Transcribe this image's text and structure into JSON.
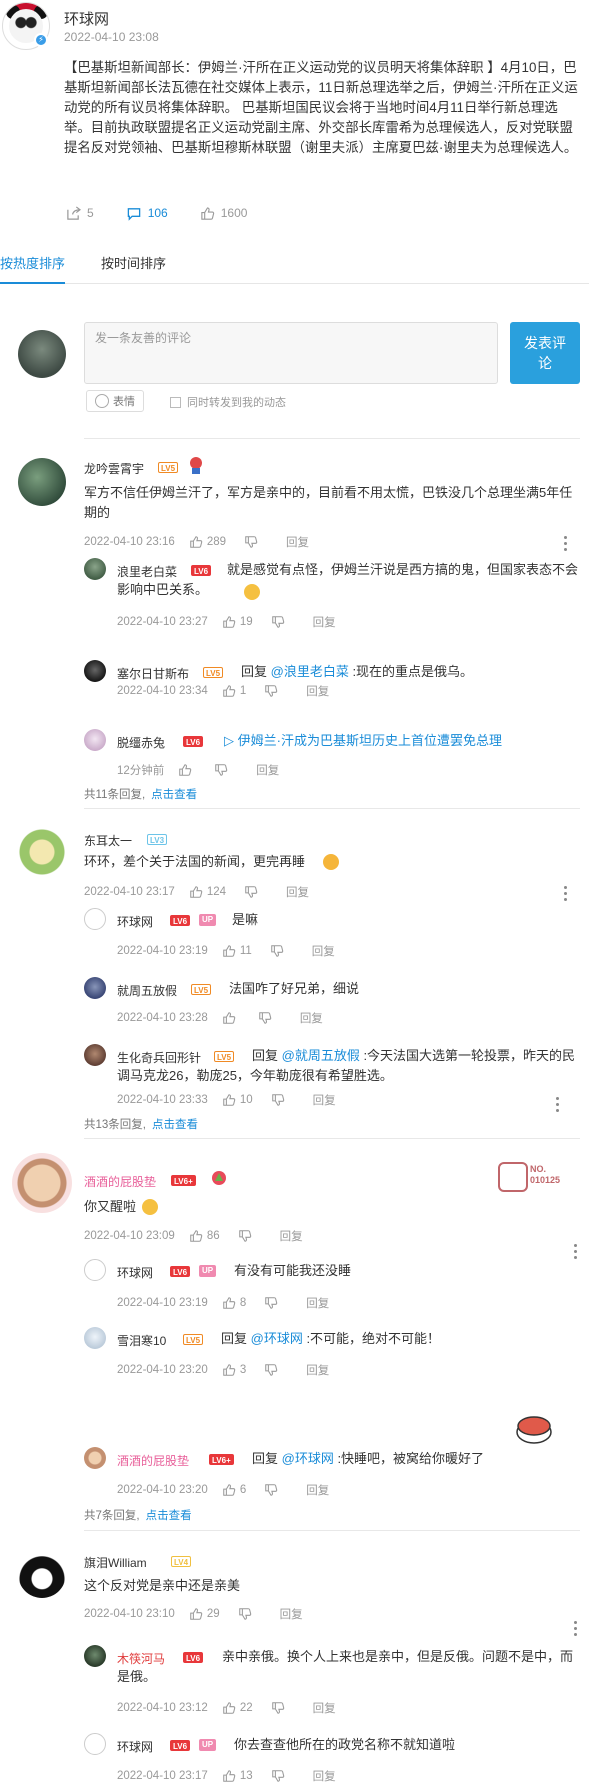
{
  "post": {
    "author": "环球网",
    "time": "2022-04-10 23:08",
    "body": "【巴基斯坦新闻部长：伊姆兰·汗所在正义运动党的议员明天将集体辞职 】4月10日，巴基斯坦新闻部长法瓦德在社交媒体上表示，11日新总理选举之后，伊姆兰·汗所在正义运动党的所有议员将集体辞职。 巴基斯坦国民议会将于当地时间4月11日举行新总理选举。目前执政联盟提名正义运动党副主席、外交部长库雷希为总理候选人，反对党联盟提名反对党领袖、巴基斯坦穆斯林联盟（谢里夫派）主席夏巴兹·谢里夫为总理候选人。",
    "reposts": "5",
    "comments": "106",
    "likes": "1600"
  },
  "tabs": [
    "按热度排序",
    "按时间排序"
  ],
  "composer": {
    "placeholder": "发一条友善的评论",
    "submit": "发表评论",
    "emoji": "表情",
    "repost": "同时转发到我的动态"
  },
  "threads": [
    {
      "name": "龙吟雲霄宇",
      "level": "LV5",
      "text": "军方不信任伊姆兰汗了，军方是亲中的，目前看不用太慌，巴铁没几个总理坐满5年任期的",
      "time": "2022-04-10 23:16",
      "likes": "289",
      "reply": "回复",
      "replies": [
        {
          "name": "浪里老白菜",
          "level": "LV6",
          "text": "就是感觉有点怪，伊姆兰汗说是西方搞的鬼，但国家表态不会影响中巴关系。",
          "time": "2022-04-10 23:27",
          "likes": "19",
          "reply": "回复"
        },
        {
          "name": "塞尔日甘斯布",
          "level": "LV5",
          "prefix": "回复 ",
          "mention": "@浪里老白菜",
          "text": " :现在的重点是俄乌。",
          "time": "2022-04-10 23:34",
          "likes": "1",
          "reply": "回复"
        },
        {
          "name": "脱缰赤兔",
          "level": "LV6",
          "link": "伊姆兰·汗成为巴基斯坦历史上首位遭罢免总理",
          "time": "12分钟前",
          "likes": "",
          "reply": "回复"
        }
      ],
      "summary_count": "共11条回复,",
      "summary_link": "点击查看"
    },
    {
      "name": "东耳太一",
      "level": "LV3",
      "text": "环环，差个关于法国的新闻，更完再睡",
      "time": "2022-04-10 23:17",
      "likes": "124",
      "reply": "回复",
      "replies": [
        {
          "name": "环球网",
          "level": "LV6",
          "up": "UP",
          "text": "是嘛",
          "time": "2022-04-10 23:19",
          "likes": "11",
          "reply": "回复"
        },
        {
          "name": "就周五放假",
          "level": "LV5",
          "text": "法国咋了好兄弟，细说",
          "time": "2022-04-10 23:28",
          "likes": "",
          "reply": "回复"
        },
        {
          "name": "生化奇兵回形针",
          "level": "LV5",
          "prefix": "回复 ",
          "mention": "@就周五放假",
          "text": " :今天法国大选第一轮投票，昨天的民调马克龙26，勒庞25，今年勒庞很有希望胜选。",
          "time": "2022-04-10 23:33",
          "likes": "10",
          "reply": "回复"
        }
      ],
      "summary_count": "共13条回复,",
      "summary_link": "点击查看"
    },
    {
      "name": "酒酒的屁股垫",
      "level": "LV6+",
      "badge_no": "NO.",
      "badge_num": "010125",
      "text": "你又醒啦",
      "time": "2022-04-10 23:09",
      "likes": "86",
      "reply": "回复",
      "replies": [
        {
          "name": "环球网",
          "level": "LV6",
          "up": "UP",
          "text": "有没有可能我还没睡",
          "time": "2022-04-10 23:19",
          "likes": "8",
          "reply": "回复"
        },
        {
          "name": "雪泪寒10",
          "level": "LV5",
          "prefix": "回复 ",
          "mention": "@环球网",
          "text": " :不可能，绝对不可能！",
          "time": "2022-04-10 23:20",
          "likes": "3",
          "reply": "回复"
        },
        {
          "name": "酒酒的屁股垫",
          "level": "LV6+",
          "prefix": "回复 ",
          "mention": "@环球网",
          "text": " :快睡吧，被窝给你暖好了",
          "time": "2022-04-10 23:20",
          "likes": "6",
          "reply": "回复"
        }
      ],
      "summary_count": "共7条回复,",
      "summary_link": "点击查看"
    },
    {
      "name": "旗泪William",
      "level": "LV4",
      "text": "这个反对党是亲中还是亲美",
      "time": "2022-04-10 23:10",
      "likes": "29",
      "reply": "回复",
      "replies": [
        {
          "name": "木筷河马",
          "level": "LV6",
          "text": "亲中亲俄。换个人上来也是亲中，但是反俄。问题不是中，而是俄。",
          "time": "2022-04-10 23:12",
          "likes": "22",
          "reply": "回复"
        },
        {
          "name": "环球网",
          "level": "LV6",
          "up": "UP",
          "text": "你去查查他所在的政党名称不就知道啦",
          "time": "2022-04-10 23:17",
          "likes": "13",
          "reply": "回复"
        }
      ]
    }
  ]
}
